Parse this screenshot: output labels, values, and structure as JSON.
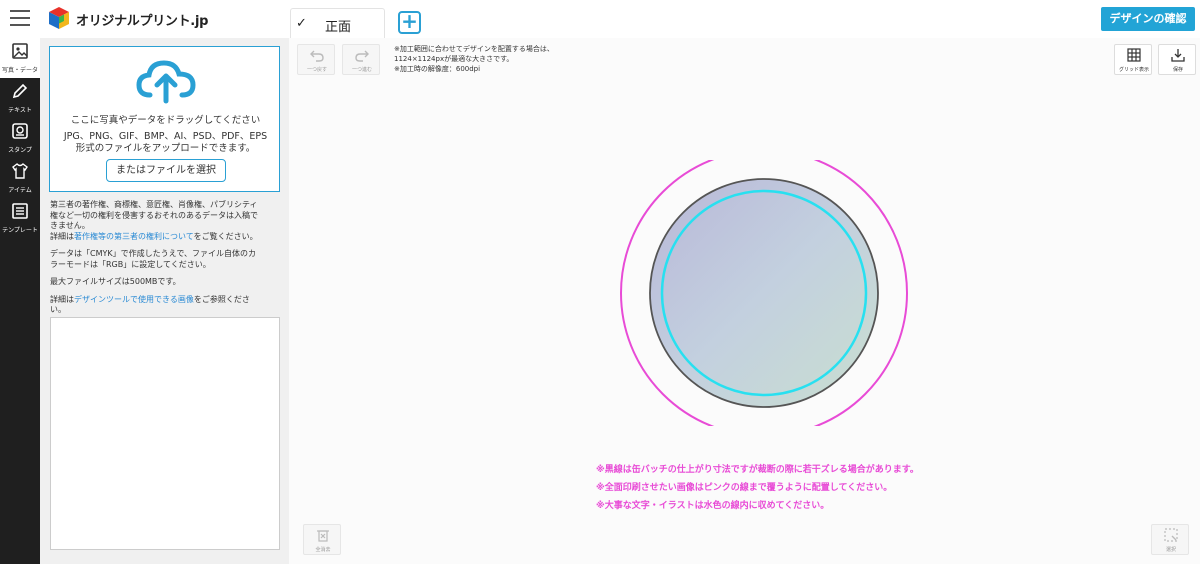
{
  "header": {
    "logo_text": "オリジナルプリント.jp",
    "tab_label": "正面",
    "tab_check": "✓",
    "add_tab": "+",
    "confirm_button": "デザインの確認"
  },
  "nav": {
    "items": [
      {
        "label": "写真・データ",
        "icon": "image-icon",
        "active": true
      },
      {
        "label": "テキスト",
        "icon": "pen-icon",
        "active": false
      },
      {
        "label": "スタンプ",
        "icon": "stamp-icon",
        "active": false
      },
      {
        "label": "アイテム",
        "icon": "tshirt-icon",
        "active": false
      },
      {
        "label": "テンプレート",
        "icon": "list-icon",
        "active": false
      }
    ]
  },
  "upload": {
    "drag_text": "ここに写真やデータをドラッグしてください",
    "formats_text": "JPG、PNG、GIF、BMP、AI、PSD、PDF、EPS",
    "upload_text": "形式のファイルをアップロードできます。",
    "select_button": "またはファイルを選択"
  },
  "notes": {
    "p1_line1": "第三者の著作権、商標権、意匠権、肖像権、パブリシティ",
    "p1_line2": "権など一切の権利を侵害するおそれのあるデータは入稿で",
    "p1_line3": "きません。",
    "p1_prefix": "詳細は",
    "p1_link": "著作権等の第三者の権利について",
    "p1_suffix": "をご覧ください。",
    "p2_line1": "データは「CMYK」で作成したうえで、ファイル自体のカ",
    "p2_line2": "ラーモードは「RGB」に設定してください。",
    "p3": "最大ファイルサイズは500MBです。",
    "p4_prefix": "詳細は",
    "p4_link": "デザインツールで使用できる画像",
    "p4_suffix": "をご参照くださ",
    "p4_line2": "い。"
  },
  "toolbar": {
    "undo": "一つ戻す",
    "redo": "一つ進む",
    "grid": "グリッド表示",
    "save": "保存",
    "clear": "全消去",
    "select": "選択"
  },
  "info": {
    "line1": "※加工範囲に合わせてデザインを配置する場合は、",
    "line2": "1124×1124pxが最適な大きさです。",
    "line3": "※加工時の解像度：600dpi"
  },
  "warnings": {
    "line1": "※黒線は缶バッチの仕上がり寸法ですが裁断の際に若干ズレる場合があります。",
    "line2": "※全面印刷させたい画像はピンクの線まで覆うように配置してください。",
    "line3": "※大事な文字・イラストは水色の線内に収めてください。"
  },
  "colors": {
    "accent": "#22a4d6",
    "pink_guide": "#e84bd6",
    "cyan_guide": "#28e0f0",
    "nav_bg": "#1f1f1f"
  }
}
